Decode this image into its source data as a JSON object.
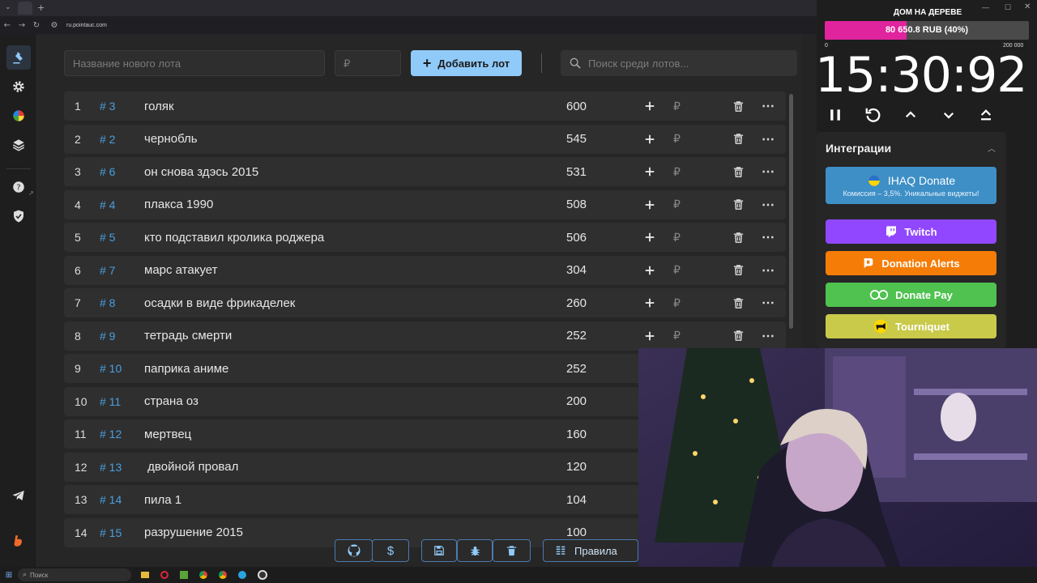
{
  "browser": {
    "url": "ru.pointauc.com"
  },
  "toolbar": {
    "name_placeholder": "Название нового лота",
    "amount_placeholder": "₽",
    "add_label": "Добавить лот",
    "search_placeholder": "Поиск среди лотов..."
  },
  "lots": [
    {
      "num": "1",
      "id": "# 3",
      "name": "голяк",
      "amount": "600"
    },
    {
      "num": "2",
      "id": "# 2",
      "name": "чернобль",
      "amount": "545"
    },
    {
      "num": "3",
      "id": "# 6",
      "name": "он снова здэсь 2015",
      "amount": "531"
    },
    {
      "num": "4",
      "id": "# 4",
      "name": "плакса 1990",
      "amount": "508"
    },
    {
      "num": "5",
      "id": "# 5",
      "name": "кто подставил кролика роджера",
      "amount": "506"
    },
    {
      "num": "6",
      "id": "# 7",
      "name": "марс атакует",
      "amount": "304"
    },
    {
      "num": "7",
      "id": "# 8",
      "name": "осадки в виде фрикаделек",
      "amount": "260"
    },
    {
      "num": "8",
      "id": "# 9",
      "name": "тетрадь смерти",
      "amount": "252"
    },
    {
      "num": "9",
      "id": "# 10",
      "name": "паприка аниме",
      "amount": "252"
    },
    {
      "num": "10",
      "id": "# 11",
      "name": "страна оз",
      "amount": "200"
    },
    {
      "num": "11",
      "id": "# 12",
      "name": "мертвец",
      "amount": "160"
    },
    {
      "num": "12",
      "id": "# 13",
      "name": " двойной провал",
      "amount": "120"
    },
    {
      "num": "13",
      "id": "# 14",
      "name": "пила 1",
      "amount": "104"
    },
    {
      "num": "14",
      "id": "# 15",
      "name": "разрушение 2015",
      "amount": "100"
    }
  ],
  "lot_currency": "₽",
  "bottom": {
    "rules_label": "Правила"
  },
  "auction": {
    "title": "ДОМ НА ДЕРЕВЕ",
    "progress_text": "80 650.8 RUB (40%)",
    "progress_fraction": 0.4,
    "scale_min": "0",
    "scale_max": "200 000",
    "timer": "15:30:92"
  },
  "integrations": {
    "title": "Интеграции",
    "ihaq_label": "IHAQ Donate",
    "ihaq_sub": "Комиссия – 3,5%. Уникальные виджеты!",
    "twitch_label": "Twitch",
    "donationalerts_label": "Donation Alerts",
    "donatepay_label": "Donate Pay",
    "tourniquet_label": "Tourniquet"
  },
  "taskbar": {
    "search_label": "Поиск"
  },
  "colors": {
    "accent": "#90caf9",
    "progress": "#e0249d",
    "twitch": "#9147ff",
    "donationalerts": "#f57d07",
    "donatepay": "#4fc24f",
    "tourniquet": "#c9c94a",
    "ihaq": "#3d8fc6"
  }
}
